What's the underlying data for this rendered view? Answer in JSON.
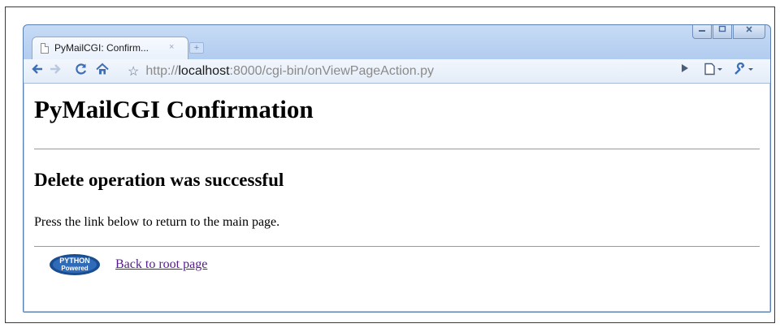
{
  "browser": {
    "tab_title": "PyMailCGI: Confirm...",
    "tab_close_glyph": "×",
    "new_tab_glyph": "+",
    "url_protocol": "http://",
    "url_host": "localhost",
    "url_path": ":8000/cgi-bin/onViewPageAction.py",
    "icons": {
      "back": "back-arrow-icon",
      "forward": "forward-arrow-icon",
      "reload": "reload-icon",
      "home": "home-icon",
      "bookmark": "star-icon",
      "go": "play-icon",
      "page_menu": "page-menu-icon",
      "tools_menu": "wrench-icon"
    },
    "colors": {
      "frame": "#a9c6ec",
      "link_visited": "#551a8b"
    }
  },
  "page": {
    "title": "PyMailCGI Confirmation",
    "subtitle": "Delete operation was successful",
    "instructions": "Press the link below to return to the main page.",
    "logo_text": {
      "line1": "PYTHON",
      "line2": "Powered"
    },
    "root_link": "Back to root page"
  }
}
